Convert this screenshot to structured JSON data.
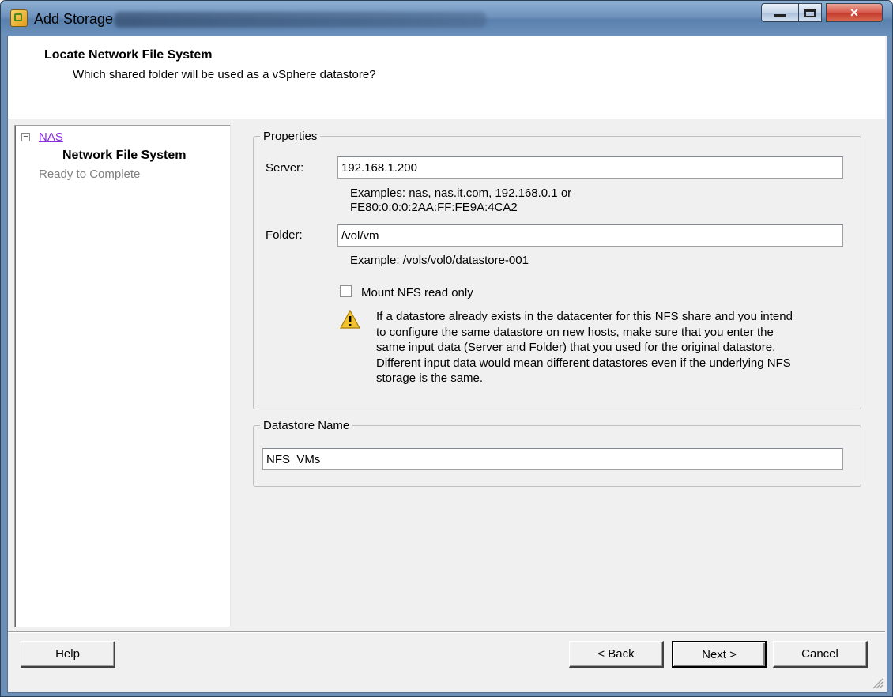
{
  "window": {
    "title": "Add Storage",
    "controls": {
      "minimize": "minimize",
      "maximize": "maximize",
      "close": "×"
    }
  },
  "header": {
    "title": "Locate Network File System",
    "subtitle": "Which shared folder will be used as a vSphere datastore?"
  },
  "nav": {
    "toggle": "−",
    "items": [
      {
        "label": "NAS",
        "state": "link"
      },
      {
        "label": "Network File System",
        "state": "current"
      },
      {
        "label": "Ready to Complete",
        "state": "disabled"
      }
    ]
  },
  "properties": {
    "legend": "Properties",
    "server_label": "Server:",
    "server_value": "192.168.1.200",
    "server_hint_line1": "Examples: nas, nas.it.com, 192.168.0.1 or",
    "server_hint_line2": "FE80:0:0:0:2AA:FF:FE9A:4CA2",
    "folder_label": "Folder:",
    "folder_value": "/vol/vm",
    "folder_hint": "Example: /vols/vol0/datastore-001",
    "readonly_label": "Mount NFS read only",
    "readonly_checked": false,
    "warning_lines": [
      "If a datastore already exists in the datacenter for this NFS share and you intend",
      "to configure the same datastore on new hosts, make sure that you enter the",
      "same input data (Server and Folder) that you used for the original datastore.",
      "Different input data would mean different datastores even if the underlying NFS",
      "storage is the same."
    ]
  },
  "datastore": {
    "legend": "Datastore Name",
    "name_value": "NFS_VMs"
  },
  "buttons": {
    "help": "Help",
    "back": "< Back",
    "next": "Next >",
    "cancel": "Cancel"
  }
}
